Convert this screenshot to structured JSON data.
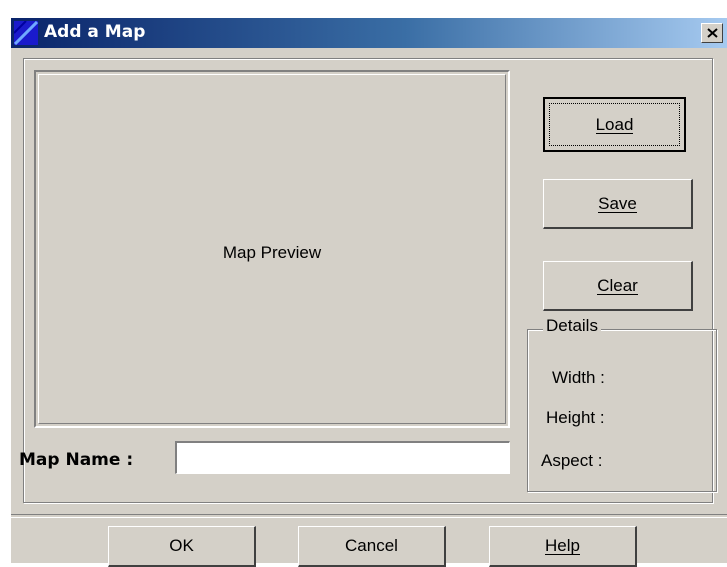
{
  "window": {
    "title": "Add a Map"
  },
  "preview": {
    "label": "Map Preview"
  },
  "side_buttons": {
    "load": {
      "label": "Load"
    },
    "save": {
      "label": "Save"
    },
    "clear": {
      "label": "Clear"
    }
  },
  "map_name": {
    "label": "Map Name :",
    "value": ""
  },
  "details": {
    "legend": "Details",
    "width_label": "Width :",
    "height_label": "Height :",
    "aspect_label": "Aspect :"
  },
  "footer": {
    "ok": "OK",
    "cancel": "Cancel",
    "help": "Help"
  },
  "colors": {
    "face": "#d4d0c8",
    "title_start": "#0a246a",
    "title_end": "#a6caf0"
  },
  "icons": {
    "title": "map-icon",
    "close": "close-icon"
  }
}
